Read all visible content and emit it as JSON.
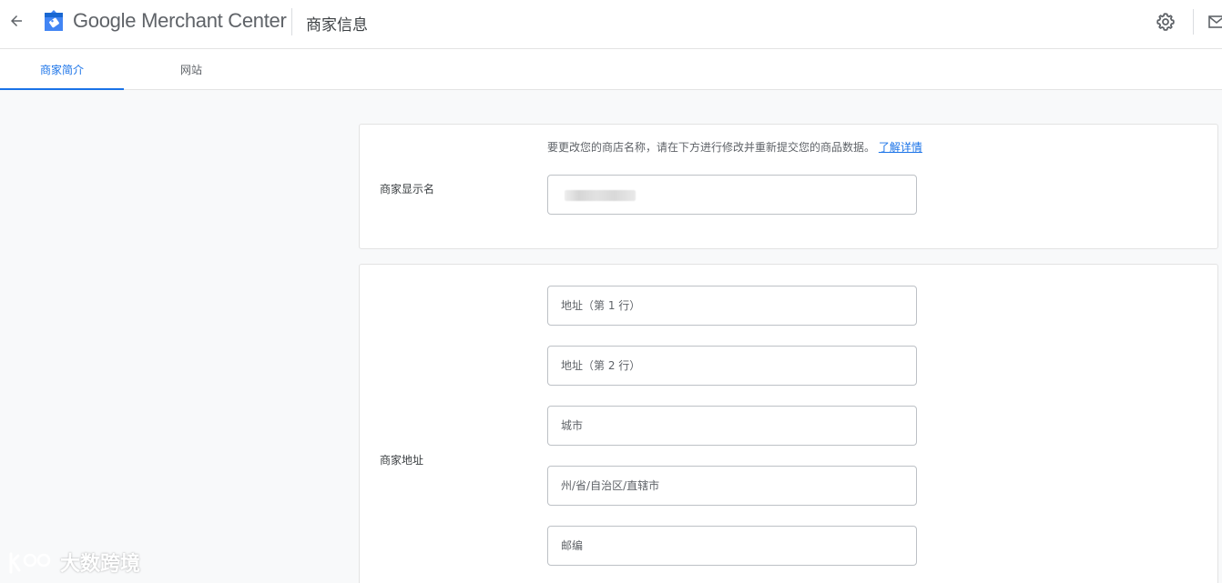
{
  "header": {
    "brand_google": "Google",
    "brand_product": "Merchant Center",
    "page_title": "商家信息"
  },
  "tabs": [
    {
      "label": "商家简介",
      "active": true
    },
    {
      "label": "网站",
      "active": false
    }
  ],
  "display_name_section": {
    "label": "商家显示名",
    "hint": "要更改您的商店名称，请在下方进行修改并重新提交您的商品数据。",
    "hint_link": "了解详情"
  },
  "address_section": {
    "label": "商家地址",
    "fields": [
      {
        "placeholder": "地址（第 1 行）"
      },
      {
        "placeholder": "地址（第 2 行）"
      },
      {
        "placeholder": "城市"
      },
      {
        "placeholder": "州/省/自治区/直辖市"
      },
      {
        "placeholder": "邮编"
      }
    ]
  },
  "watermark": "大数跨境",
  "colors": {
    "accent": "#1a73e8",
    "background": "#f8f9fa",
    "card": "#ffffff",
    "border": "#e3e3e3",
    "logo_blue": "#4285f4"
  }
}
